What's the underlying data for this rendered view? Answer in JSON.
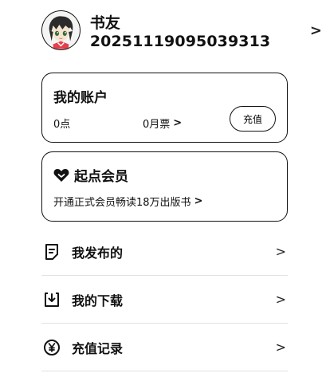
{
  "profile": {
    "username": "书友20251119095039313",
    "chevron_icon": "chevron-right-icon"
  },
  "account": {
    "title": "我的账户",
    "points": "0点",
    "monthly_tickets": "0月票",
    "recharge_label": "充值"
  },
  "vip": {
    "icon": "heart-icon",
    "title": "起点会员",
    "subtitle": "开通正式会员畅读18万出版书"
  },
  "menu": {
    "items": [
      {
        "label": "我发布的",
        "icon": "document-edit-icon"
      },
      {
        "label": "我的下载",
        "icon": "download-icon"
      },
      {
        "label": "充值记录",
        "icon": "yen-coin-icon"
      }
    ]
  },
  "glyphs": {
    "chevron": "›",
    "chevron_small": ">"
  }
}
